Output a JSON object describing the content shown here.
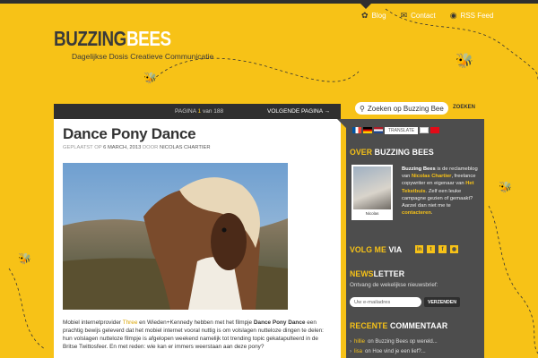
{
  "nav": {
    "items": [
      {
        "label": "Blog",
        "icon": "bee-icon",
        "active": true
      },
      {
        "label": "Contact",
        "icon": "envelope-icon"
      },
      {
        "label": "RSS Feed",
        "icon": "rss-icon"
      }
    ]
  },
  "brand": {
    "name_part1": "BUZZING",
    "name_part2": "BEES",
    "tagline": "Dagelijkse Dosis Creatieve Communicatie"
  },
  "pager": {
    "prefix": "PAGINA",
    "current": "1",
    "sep": "van",
    "total": "188",
    "next": "VOLGENDE PAGINA →"
  },
  "post": {
    "title": "Dance Pony Dance",
    "meta_prefix": "GEPLAATST OP",
    "date": "6 MARCH, 2013",
    "meta_by": "DOOR",
    "author": "NICOLAS CHARTIER",
    "body_1": "Mobiel internetprovider",
    "body_three": "Three",
    "body_2": "en Wieden+Kennedy hebben met het filmpje",
    "body_bold": "Dance Pony Dance",
    "body_3": "een prachtig bewijs geleverd dat het mobiel internet vooral nuttig is om volslagen nutteloze dingen te delen: hun volslagen nutteloze filmpje is afgelopen weekend namelijk tot trending topic gekatapulteerd in de Britse Twittosfeer. En met reden: wie kan er immers weerstaan aan deze pony?"
  },
  "search": {
    "placeholder": "Zoeken op Buzzing Bee",
    "button": "ZOEKEN"
  },
  "sidebar": {
    "translate": "TRANSLATE",
    "about_h1": "OVER",
    "about_h2": "BUZZING BEES",
    "about_name": "Buzzing Bees",
    "about_t1": "is de reclameblog van",
    "about_link1": "Nicolas Chartier",
    "about_t2": ", freelance copywriter en eigenaar van",
    "about_link2": "Het Tekstbuis",
    "about_t3": ". Zelf een leuke campagne gezien of gemaakt? Aarzel dan niet me te",
    "about_link3": "contacteren",
    "about_t4": ".",
    "avatar_caption": "Nicolas",
    "follow_h1": "VOLG ME",
    "follow_h2": "VIA",
    "social": [
      {
        "icon": "linkedin-icon",
        "glyph": "in"
      },
      {
        "icon": "twitter-icon",
        "glyph": "t"
      },
      {
        "icon": "facebook-icon",
        "glyph": "f"
      },
      {
        "icon": "rss-icon",
        "glyph": "◉"
      }
    ],
    "newsletter_h1": "NEWS",
    "newsletter_h2": "LETTER",
    "newsletter_sub": "Ontvang de wekelijkse nieuwsbrief:",
    "newsletter_placeholder": "Uw e-mailadres",
    "newsletter_button": "VERZENDEN",
    "recent_h1": "RECENTE",
    "recent_h2": "COMMENTAAR",
    "recent": [
      {
        "user": "hillie",
        "text": "on Buzzing Bees op wereld..."
      },
      {
        "user": "lisa",
        "text": "on Hoe vind je een lief?..."
      }
    ]
  },
  "colors": {
    "accent": "#f7c217",
    "dark": "#2f2f2f",
    "sidebar": "#4d4d4d"
  }
}
